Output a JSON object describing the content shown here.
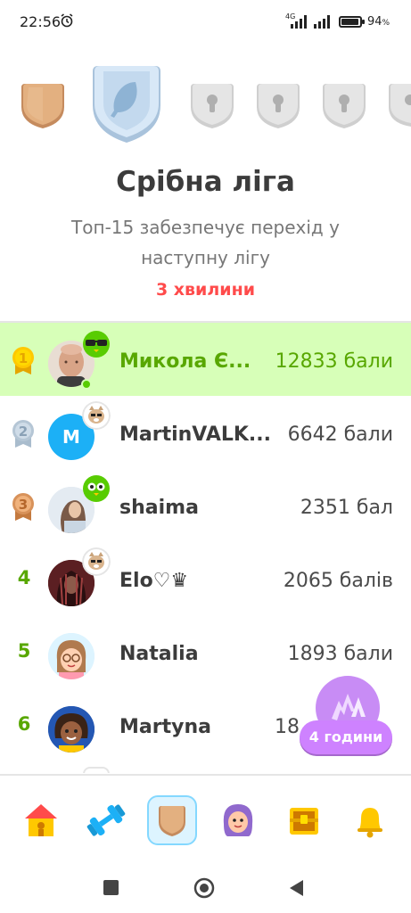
{
  "status_bar": {
    "time": "22:56",
    "alarm_icon": "alarm-clock-icon",
    "network": "4G",
    "battery_percent": "94",
    "battery_suffix": "%"
  },
  "league": {
    "title": "Срібна ліга",
    "subtitle": "Топ-15 забезпечує перехід у наступну лігу",
    "time_left": "3 хвилини",
    "shields": [
      {
        "name": "bronze",
        "state": "completed",
        "color": "#d9a270"
      },
      {
        "name": "silver",
        "state": "current",
        "color": "#c8dcf0"
      },
      {
        "name": "locked",
        "state": "locked",
        "color": "#e0e0e0"
      },
      {
        "name": "locked",
        "state": "locked",
        "color": "#e0e0e0"
      },
      {
        "name": "locked",
        "state": "locked",
        "color": "#e0e0e0"
      },
      {
        "name": "locked",
        "state": "locked",
        "color": "#e0e0e0"
      }
    ]
  },
  "leaderboard": [
    {
      "rank": "1",
      "name": "Микола Є...",
      "score": "12833 бали",
      "is_me": true,
      "avatar_icon": "photo-avatar",
      "badge_icon": "owl-sunglasses-icon"
    },
    {
      "rank": "2",
      "name": "MartinVALK...",
      "score": "6642 бали",
      "is_me": false,
      "avatar_icon": "letter-avatar",
      "avatar_letter": "M",
      "badge_icon": "cat-icon"
    },
    {
      "rank": "3",
      "name": "shaima",
      "score": "2351 бал",
      "is_me": false,
      "avatar_icon": "photo-avatar",
      "badge_icon": "green-owl-icon"
    },
    {
      "rank": "4",
      "name": "Elo♡♛",
      "score": "2065 балів",
      "is_me": false,
      "avatar_icon": "photo-avatar",
      "badge_icon": "cat-icon"
    },
    {
      "rank": "5",
      "name": "Natalia",
      "score": "1893 бали",
      "is_me": false,
      "avatar_icon": "cartoon-avatar"
    },
    {
      "rank": "6",
      "name": "Martyna",
      "score": "18",
      "is_me": false,
      "avatar_icon": "cartoon-avatar"
    }
  ],
  "boost": {
    "label": "4 години",
    "icon": "boost-arrows-icon"
  },
  "bottom_nav": [
    {
      "name": "home",
      "icon": "home-icon",
      "active": false
    },
    {
      "name": "practice",
      "icon": "dumbbell-icon",
      "active": false
    },
    {
      "name": "leagues",
      "icon": "shield-icon",
      "active": true
    },
    {
      "name": "profile",
      "icon": "character-icon",
      "active": false
    },
    {
      "name": "shop",
      "icon": "chest-icon",
      "active": false
    },
    {
      "name": "notifications",
      "icon": "bell-icon",
      "active": false
    }
  ],
  "colors": {
    "accent_green": "#58a700",
    "highlight_row": "#d7ffb8",
    "timer_red": "#ff4b4b",
    "boost_purple": "#ce82ff"
  }
}
